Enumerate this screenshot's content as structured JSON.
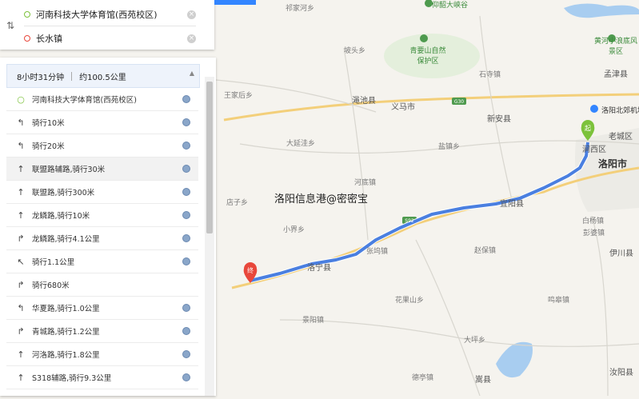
{
  "colors": {
    "route": "#4a7fe0",
    "start_marker": "#7cc23b",
    "end_marker": "#e8473b",
    "map_bg": "#f5f3ee"
  },
  "search": {
    "start": "河南科技大学体育馆(西苑校区)",
    "end": "长水镇"
  },
  "summary": {
    "time": "8小时31分钟",
    "distance": "约100.5公里"
  },
  "steps": [
    {
      "icon": "start-dot-icon",
      "text": "河南科技大学体育馆(西苑校区)"
    },
    {
      "icon": "turn-left-icon",
      "text": "骑行10米"
    },
    {
      "icon": "turn-left-icon",
      "text": "骑行20米"
    },
    {
      "icon": "straight-icon",
      "text": "联盟路辅路,骑行30米"
    },
    {
      "icon": "straight-icon",
      "text": "联盟路,骑行300米"
    },
    {
      "icon": "straight-icon",
      "text": "龙鳞路,骑行10米"
    },
    {
      "icon": "turn-right-icon",
      "text": "龙鳞路,骑行4.1公里"
    },
    {
      "icon": "slight-left-icon",
      "text": "骑行1.1公里"
    },
    {
      "icon": "turn-right-icon",
      "text": "骑行680米"
    },
    {
      "icon": "turn-left-icon",
      "text": "华夏路,骑行1.0公里"
    },
    {
      "icon": "turn-right-icon",
      "text": "青城路,骑行1.2公里"
    },
    {
      "icon": "straight-icon",
      "text": "河洛路,骑行1.8公里"
    },
    {
      "icon": "straight-icon",
      "text": "S318辅路,骑行9.3公里"
    }
  ],
  "map": {
    "watermark": "洛阳信息港@密密宝",
    "start_marker_label": "起",
    "end_marker_label": "终",
    "highway_shields": [
      "G30",
      "S92"
    ],
    "places": {
      "cities": [
        "洛阳市"
      ],
      "counties": [
        "渑池县",
        "义马市",
        "新安县",
        "宜阳县",
        "洛宁县",
        "伊川县",
        "嵩县",
        "汝阳县",
        "涧西区",
        "老城区",
        "孟津县"
      ],
      "towns": [
        "坡头乡",
        "石寺镇",
        "王家后乡",
        "大延洼乡",
        "盐镇乡",
        "河底镇",
        "店子乡",
        "小界乡",
        "张坞镇",
        "赵保镇",
        "花果山乡",
        "景阳镇",
        "大坪乡",
        "德亭镇",
        "白杨镇",
        "彭婆镇",
        "鸣皋镇",
        "祁家河乡"
      ],
      "pois": [
        "仰韶大峡谷",
        "青要山自然保护区",
        "黄河小浪底风景区",
        "洛阳北郊机场"
      ]
    }
  }
}
